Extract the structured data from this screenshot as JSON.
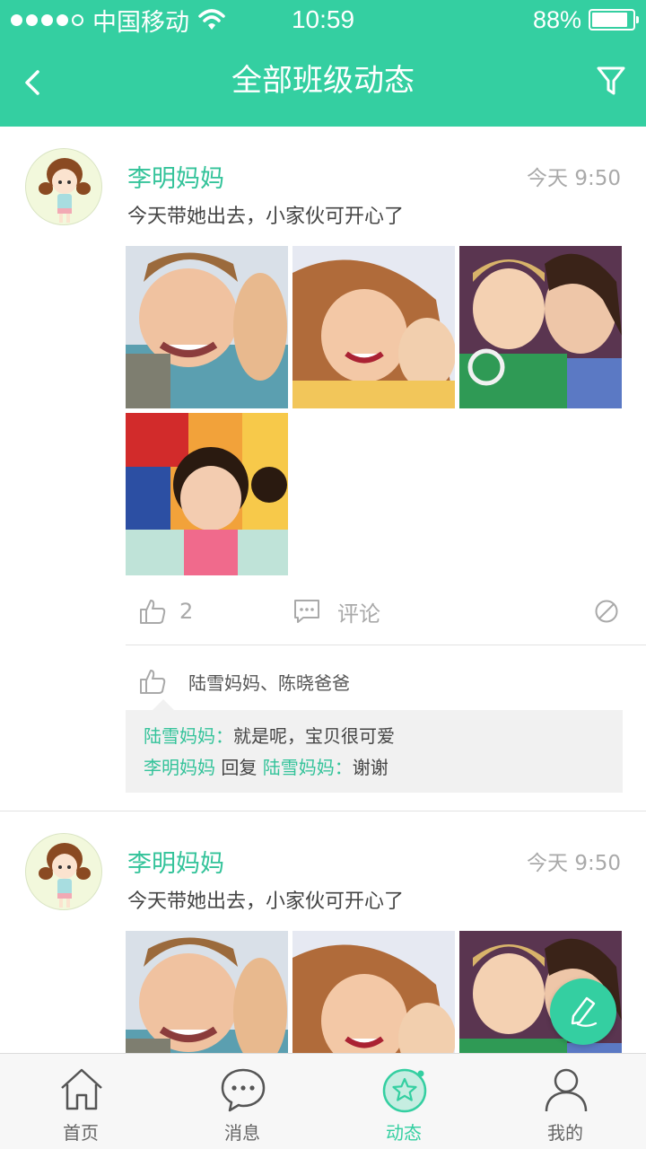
{
  "status_bar": {
    "carrier": "中国移动",
    "time": "10:59",
    "battery": "88%",
    "battery_level": 0.88,
    "signal_bars": 4
  },
  "nav": {
    "title": "全部班级动态",
    "back_icon": "back-arrow-icon",
    "filter_icon": "filter-icon"
  },
  "posts": [
    {
      "author": "李明妈妈",
      "time": "今天 9:50",
      "text": "今天带她出去，小家伙可开心了",
      "like_count": "2",
      "comment_label": "评论",
      "likers": "陆雪妈妈、陈晓爸爸",
      "comments": [
        {
          "name": "陆雪妈妈",
          "separator": "：",
          "text": "就是呢，宝贝很可爱"
        },
        {
          "name": "李明妈妈",
          "reply_word": "回复",
          "reply_to": "陆雪妈妈",
          "separator": "：",
          "text": "谢谢"
        }
      ]
    },
    {
      "author": "李明妈妈",
      "time": "今天 9:50",
      "text": "今天带她出去，小家伙可开心了"
    }
  ],
  "tabs": [
    {
      "label": "首页",
      "icon": "home-icon",
      "active": false
    },
    {
      "label": "消息",
      "icon": "message-icon",
      "active": false
    },
    {
      "label": "动态",
      "icon": "star-icon",
      "active": true
    },
    {
      "label": "我的",
      "icon": "user-icon",
      "active": false
    }
  ],
  "colors": {
    "accent": "#34cfa1",
    "name_text": "#34c39a",
    "muted_text": "#a9a9a9",
    "tab_bar_bg": "#f7f7f7"
  }
}
